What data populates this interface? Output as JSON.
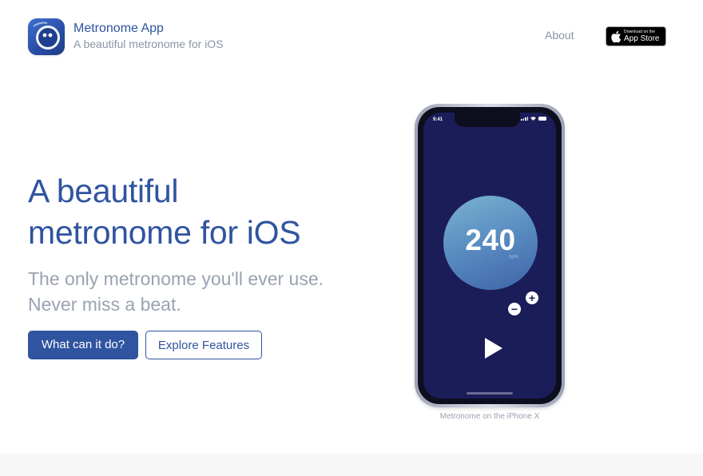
{
  "brand": {
    "title": "Metronome App",
    "subtitle": "A beautiful metronome for iOS"
  },
  "nav": {
    "about_label": "About",
    "app_store": {
      "line1": "Download on the",
      "line2": "App Store"
    }
  },
  "hero": {
    "title_line1": "A beautiful",
    "title_line2": "metronome for iOS",
    "subtitle_line1": "The only metronome you'll ever use.",
    "subtitle_line2": "Never miss a beat.",
    "primary_button": "What can it do?",
    "secondary_button": "Explore Features"
  },
  "phone": {
    "status_time": "9:41",
    "tempo": "240",
    "tempo_unit": "bpm",
    "minus_symbol": "−",
    "plus_symbol": "+",
    "caption": "Metronome on the iPhone X"
  },
  "colors": {
    "primary": "#2f54a0",
    "muted_text": "#9aa2b1",
    "phone_screen": "#1b1d59",
    "tempo_circle_light": "#7db2d0",
    "tempo_circle_dark": "#3f63a8"
  },
  "icons": {
    "app_icon": "metronome-app-icon",
    "apple_logo": "apple-logo-icon",
    "play": "play-icon",
    "minus": "minus-icon",
    "plus": "plus-icon"
  }
}
